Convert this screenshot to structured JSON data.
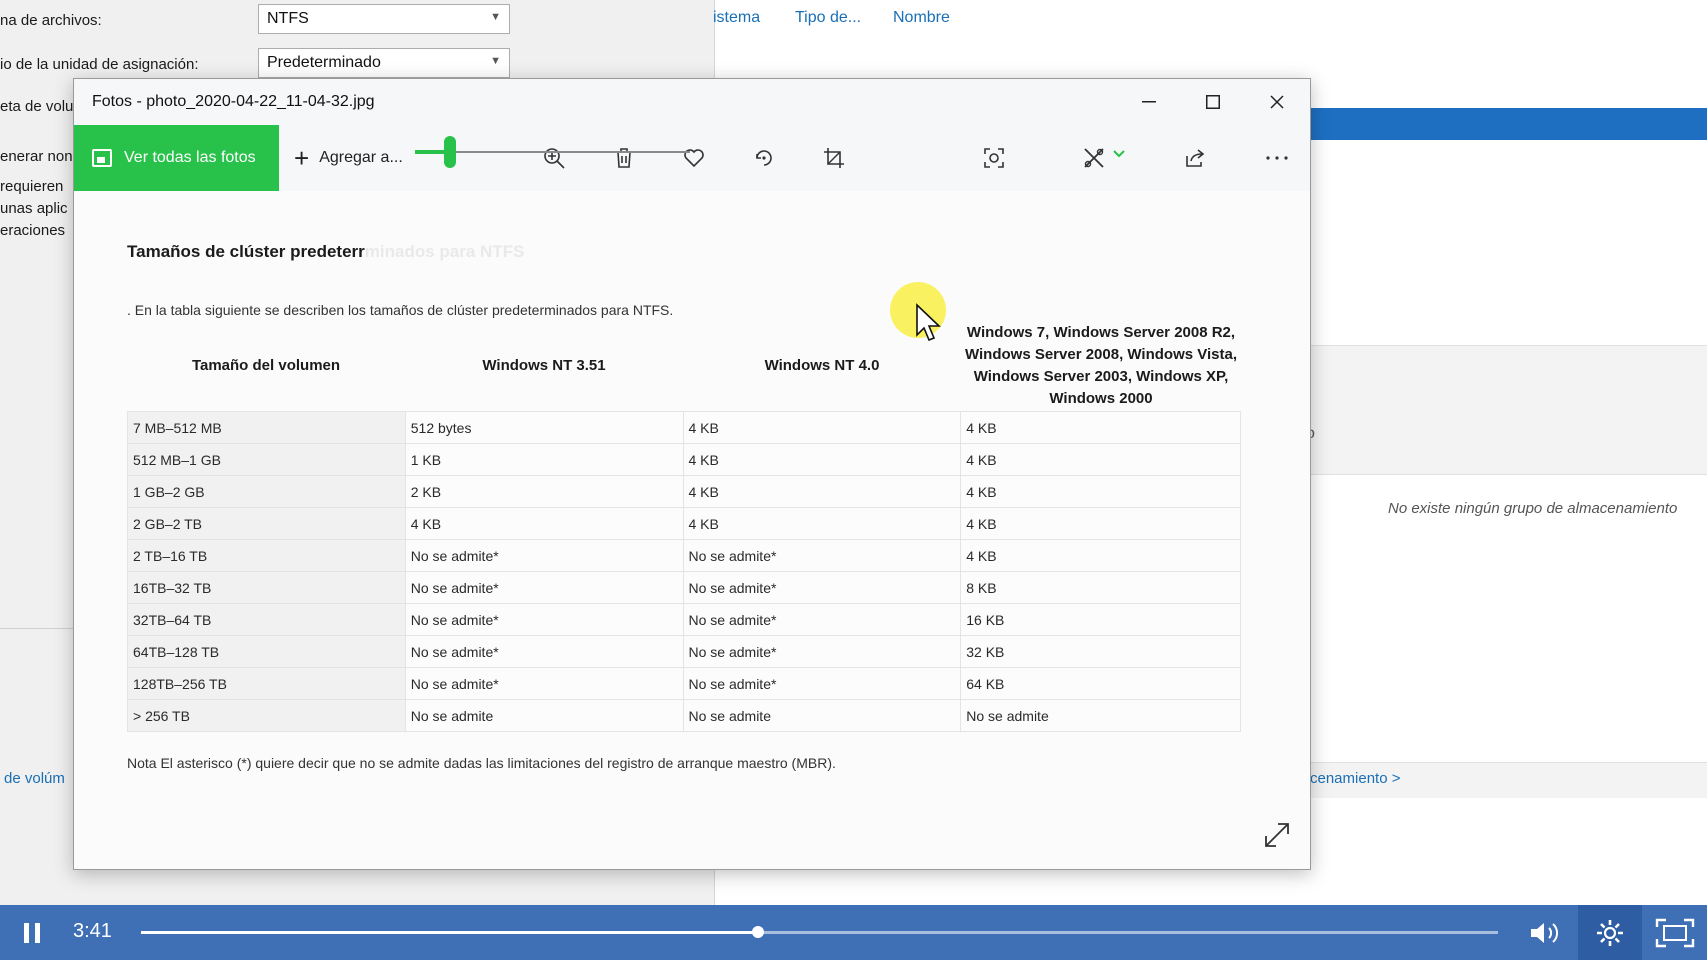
{
  "background": {
    "format_dialog": {
      "filesystem_label": "na de archivos:",
      "filesystem_value": "NTFS",
      "allocation_label": "io de la unidad de asignación:",
      "allocation_value": "Predeterminado",
      "volume_label": "eta de volu",
      "generate_label": "enerar non",
      "info_line1": "requieren",
      "info_line2": "unas aplic",
      "info_line3": "eraciones",
      "volumes_link": "de volúm"
    },
    "columns": [
      "istema",
      "Tipo de...",
      "Nombre"
    ],
    "partial_glyph": "o",
    "empty_message": "No existe ningún grupo de almacenamiento",
    "storage_link": "cenamiento >"
  },
  "photos": {
    "title": "Fotos - photo_2020-04-22_11-04-32.jpg",
    "toolbar": {
      "see_all": "Ver todas las fotos",
      "add_to": "Agregar a..."
    },
    "zoom_level": 0.12,
    "document": {
      "heading_visible": "Tamaños de clúster predeterr",
      "heading_faded": "minados para NTFS",
      "intro": ". En la tabla siguiente se describen los tamaños de clúster predeterminados para NTFS.",
      "table": {
        "headers": [
          "Tamaño del volumen",
          "Windows NT 3.51",
          "Windows NT 4.0",
          "Windows 7, Windows Server 2008 R2, Windows Server 2008, Windows Vista, Windows Server 2003, Windows XP, Windows 2000"
        ],
        "rows": [
          [
            "7 MB–512 MB",
            "512 bytes",
            "4 KB",
            "4 KB"
          ],
          [
            "512 MB–1 GB",
            "1 KB",
            "4 KB",
            "4 KB"
          ],
          [
            "1 GB–2 GB",
            "2 KB",
            "4 KB",
            "4 KB"
          ],
          [
            "2 GB–2 TB",
            "4 KB",
            "4 KB",
            "4 KB"
          ],
          [
            "2 TB–16 TB",
            "No se admite*",
            "No se admite*",
            "4 KB"
          ],
          [
            "16TB–32 TB",
            "No se admite*",
            "No se admite*",
            "8 KB"
          ],
          [
            "32TB–64 TB",
            "No se admite*",
            "No se admite*",
            "16 KB"
          ],
          [
            "64TB–128 TB",
            "No se admite*",
            "No se admite*",
            "32 KB"
          ],
          [
            "128TB–256 TB",
            "No se admite*",
            "No se admite*",
            "64 KB"
          ],
          [
            "> 256 TB",
            "No se admite",
            "No se admite",
            "No se admite"
          ]
        ]
      },
      "note": "Nota El asterisco (*) quiere decir que no se admite dadas las limitaciones del registro de arranque maestro (MBR)."
    }
  },
  "player": {
    "current_time": "3:41",
    "progress": 0.455,
    "accent": "#3f6fb5"
  }
}
